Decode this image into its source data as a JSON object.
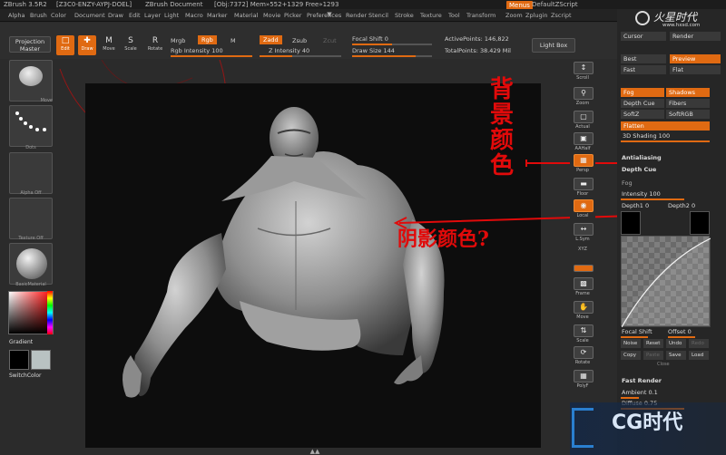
{
  "titlebar": {
    "app": "ZBrush 3.5R2",
    "serial": "[Z3C0-ENZY-AYPJ-DOEL]",
    "doc": "ZBrush Document",
    "stats": "[Obj:7372] Mem»552+1329 Free»1293",
    "menus_btn": "Menus",
    "script_btn": "DefaultZScript"
  },
  "menubar": [
    "Alpha",
    "Brush",
    "Color",
    "Document",
    "Draw",
    "Edit",
    "Layer",
    "Light",
    "Macro",
    "Marker",
    "Material",
    "Movie",
    "Picker",
    "Preferences",
    "Render",
    "Stencil",
    "Stroke",
    "Texture",
    "Tool",
    "Transform",
    "Zoom",
    "Zplugin",
    "Zscript"
  ],
  "toolbar": {
    "projection_master": "Projection Master",
    "edit": "Edit",
    "draw": "Draw",
    "move": "Move",
    "scale": "Scale",
    "rotate": "Rotate",
    "mrgb": "Mrgb",
    "rgb": "Rgb",
    "m": "M",
    "rgb_intensity": "Rgb Intensity 100",
    "zadd": "Zadd",
    "zsub": "Zsub",
    "zcut": "Zcut",
    "z_intensity": "Z Intensity 40",
    "focal_shift": "Focal Shift 0",
    "draw_size": "Draw Size 144",
    "active_points": "ActivePoints: 146,822",
    "total_points": "TotalPoints: 38.429 Mil",
    "light_box": "Light Box"
  },
  "leftpanel": {
    "brush_label": "Move",
    "stroke_label": "Dots",
    "alpha_label": "Alpha Off",
    "texture_label": "Texture Off",
    "material_label": "BasicMaterial",
    "gradient": "Gradient",
    "switch_color": "SwitchColor"
  },
  "shelf": [
    "Scroll",
    "Zoom",
    "Actual",
    "AAHalf",
    "Persp",
    "Floor",
    "Local",
    "L.Sym",
    "Frame",
    "Move",
    "Scale",
    "Rotate",
    "PolyF"
  ],
  "shelf_xyz": "XYZ",
  "rpanel": {
    "cursor": "Cursor",
    "render": "Render",
    "best": "Best",
    "preview": "Preview",
    "fast": "Fast",
    "flat": "Flat",
    "fog": "Fog",
    "shadows": "Shadows",
    "depth_cue": "Depth Cue",
    "fibers": "Fibers",
    "softz": "SoftZ",
    "softrgb": "SoftRGB",
    "flatten": "Flatten",
    "shading": "3D Shading 100",
    "antialiasing": "Antialiasing",
    "depth_cue2": "Depth Cue",
    "fog_section": "Fog",
    "intensity": "Intensity 100",
    "depth1": "Depth1 0",
    "depth2": "Depth2 0",
    "focal_shift": "Focal Shift",
    "offset": "Offset 0",
    "noise": "Noise",
    "reset": "Reset",
    "undo": "Undo",
    "redo": "Redo",
    "copy": "Copy",
    "paste": "Paste",
    "save": "Save",
    "load": "Load",
    "close": "Close",
    "fast_render": "Fast Render",
    "ambient": "Ambient 0.1",
    "diffuse": "Diffuse 0.75"
  },
  "watermark": {
    "top_text": "火星时代",
    "top_url": "www.hxsd.com",
    "bottom_text": "CG时代"
  },
  "annotations": {
    "background_color": "背景颜色",
    "shadow_color": "阴影颜色?"
  },
  "colors": {
    "accent": "#e06a12",
    "annotation": "#e10a0a"
  }
}
